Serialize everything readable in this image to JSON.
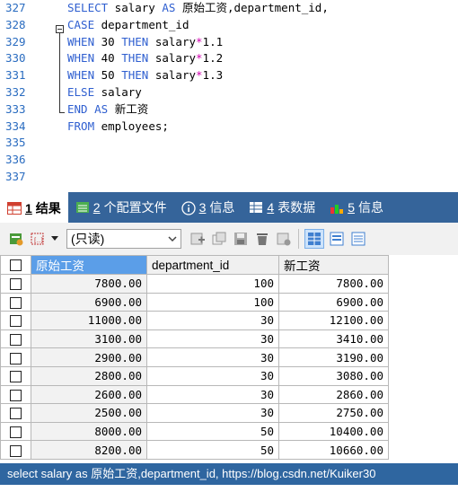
{
  "editor": {
    "lines": [
      {
        "no": "327",
        "code": [
          {
            "t": "SELECT",
            "k": "kw"
          },
          {
            "t": " salary ",
            "k": ""
          },
          {
            "t": "AS",
            "k": "kw"
          },
          {
            "t": " 原始工资,department_id,",
            "k": ""
          }
        ]
      },
      {
        "no": "328",
        "code": [
          {
            "t": "CASE",
            "k": "kw"
          },
          {
            "t": " department_id",
            "k": ""
          }
        ]
      },
      {
        "no": "329",
        "code": [
          {
            "t": "WHEN",
            "k": "kw"
          },
          {
            "t": " 30 ",
            "k": ""
          },
          {
            "t": "THEN",
            "k": "kw"
          },
          {
            "t": " salary",
            "k": ""
          },
          {
            "t": "*",
            "k": "op"
          },
          {
            "t": "1.1",
            "k": ""
          }
        ]
      },
      {
        "no": "330",
        "code": [
          {
            "t": "WHEN",
            "k": "kw"
          },
          {
            "t": " 40 ",
            "k": ""
          },
          {
            "t": "THEN",
            "k": "kw"
          },
          {
            "t": " salary",
            "k": ""
          },
          {
            "t": "*",
            "k": "op"
          },
          {
            "t": "1.2",
            "k": ""
          }
        ]
      },
      {
        "no": "331",
        "code": [
          {
            "t": "WHEN",
            "k": "kw"
          },
          {
            "t": " 50 ",
            "k": ""
          },
          {
            "t": "THEN",
            "k": "kw"
          },
          {
            "t": " salary",
            "k": ""
          },
          {
            "t": "*",
            "k": "op"
          },
          {
            "t": "1.3",
            "k": ""
          }
        ]
      },
      {
        "no": "332",
        "code": [
          {
            "t": "ELSE",
            "k": "kw"
          },
          {
            "t": " salary",
            "k": ""
          }
        ]
      },
      {
        "no": "333",
        "code": [
          {
            "t": "END",
            "k": "kw"
          },
          {
            "t": " ",
            "k": ""
          },
          {
            "t": "AS",
            "k": "kw"
          },
          {
            "t": " 新工资",
            "k": ""
          }
        ]
      },
      {
        "no": "334",
        "code": [
          {
            "t": "FROM",
            "k": "kw"
          },
          {
            "t": " employees;",
            "k": ""
          }
        ]
      },
      {
        "no": "335",
        "code": []
      },
      {
        "no": "336",
        "code": []
      },
      {
        "no": "337",
        "code": []
      }
    ]
  },
  "tabs": [
    {
      "num": "1",
      "label": "结果",
      "active": true,
      "icon": "table-result-icon"
    },
    {
      "num": "2",
      "label": "个配置文件",
      "active": false,
      "icon": "profile-icon"
    },
    {
      "num": "3",
      "label": "信息",
      "active": false,
      "icon": "info-icon"
    },
    {
      "num": "4",
      "label": "表数据",
      "active": false,
      "icon": "table-data-icon"
    },
    {
      "num": "5",
      "label": "信息",
      "active": false,
      "icon": "info-chart-icon"
    }
  ],
  "toolbar": {
    "mode_select": "(只读)"
  },
  "grid": {
    "columns": [
      "原始工资",
      "department_id",
      "新工资"
    ],
    "rows": [
      [
        "7800.00",
        "100",
        "7800.00"
      ],
      [
        "6900.00",
        "100",
        "6900.00"
      ],
      [
        "11000.00",
        "30",
        "12100.00"
      ],
      [
        "3100.00",
        "30",
        "3410.00"
      ],
      [
        "2900.00",
        "30",
        "3190.00"
      ],
      [
        "2800.00",
        "30",
        "3080.00"
      ],
      [
        "2600.00",
        "30",
        "2860.00"
      ],
      [
        "2500.00",
        "30",
        "2750.00"
      ],
      [
        "8000.00",
        "50",
        "10400.00"
      ],
      [
        "8200.00",
        "50",
        "10660.00"
      ]
    ]
  },
  "status": {
    "text": "select salary as 原始工资,department_id, https://blog.csdn.net/Kuiker30"
  },
  "colors": {
    "keyword": "#2f5fd0",
    "tabbar": "#35649a",
    "header_highlight": "#5b9ee8",
    "statusbar": "#2f66a0"
  }
}
